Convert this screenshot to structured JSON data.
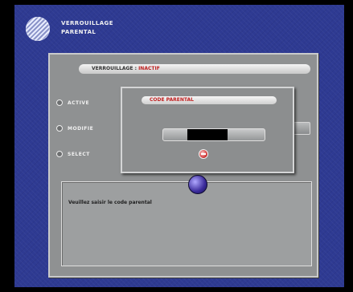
{
  "header": {
    "title_line1": "VERROUILLAGE",
    "title_line2": "PARENTAL"
  },
  "status": {
    "label": "VERROUILLAGE : ",
    "value": "INACTIF"
  },
  "options": [
    {
      "label": "ACTIVE"
    },
    {
      "label": "MODIFIE"
    },
    {
      "label": "SELECT"
    }
  ],
  "dialog": {
    "title": "CODE PARENTAL"
  },
  "info": {
    "text": "Veuillez saisir le code parental"
  },
  "colors": {
    "background": "#2e3a92",
    "panel": "#8f9192",
    "accent": "#c02020"
  },
  "icons": {
    "logo": "striped-globe-icon",
    "validate": "red-round-button-icon",
    "mascot": "purple-orb-icon"
  }
}
